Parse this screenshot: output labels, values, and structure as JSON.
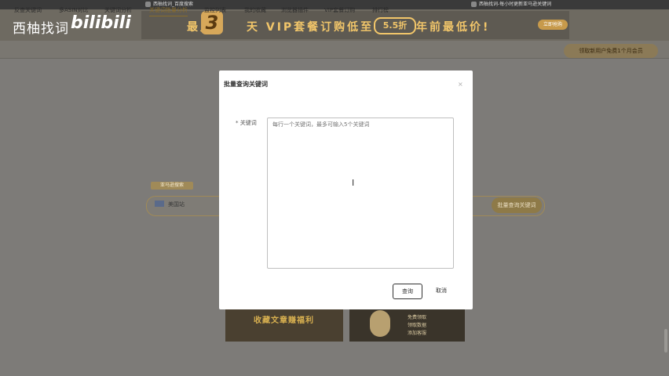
{
  "browser": {
    "tab1": "西柚找词_百度搜索",
    "tab2": "西柚找词-每小时更新亚马逊关键词"
  },
  "header": {
    "logo": "西柚找词",
    "bili": "bilibili"
  },
  "banner": {
    "prefix": "最后",
    "number": "3",
    "middle": "天 VIP套餐订购低至",
    "discount": "5.5折",
    "suffix": "年前最低价!",
    "button": "立即抢购"
  },
  "nav": {
    "items": [
      "反查关键词",
      "多ASIN对比",
      "关键词分析",
      "关键词批量分析",
      "监控列表",
      "我的收藏",
      "浏览器插件",
      "VIP套餐订购",
      "排行榜"
    ],
    "active_index": 3,
    "vip_badge": "领取新用户免费1个月会员"
  },
  "search": {
    "tag": "亚马逊搜索",
    "site": "美国站",
    "button": "批量查询关键词"
  },
  "promos": {
    "left": "收藏文章赚福利",
    "right_items": [
      "免费领取",
      "领取数据",
      "添加客服"
    ]
  },
  "modal": {
    "title": "批量查询关键词",
    "close": "×",
    "field_label": "* 关键词",
    "placeholder": "每行一个关键词，最多可输入5个关键词",
    "ok": "查询",
    "cancel": "取消"
  }
}
